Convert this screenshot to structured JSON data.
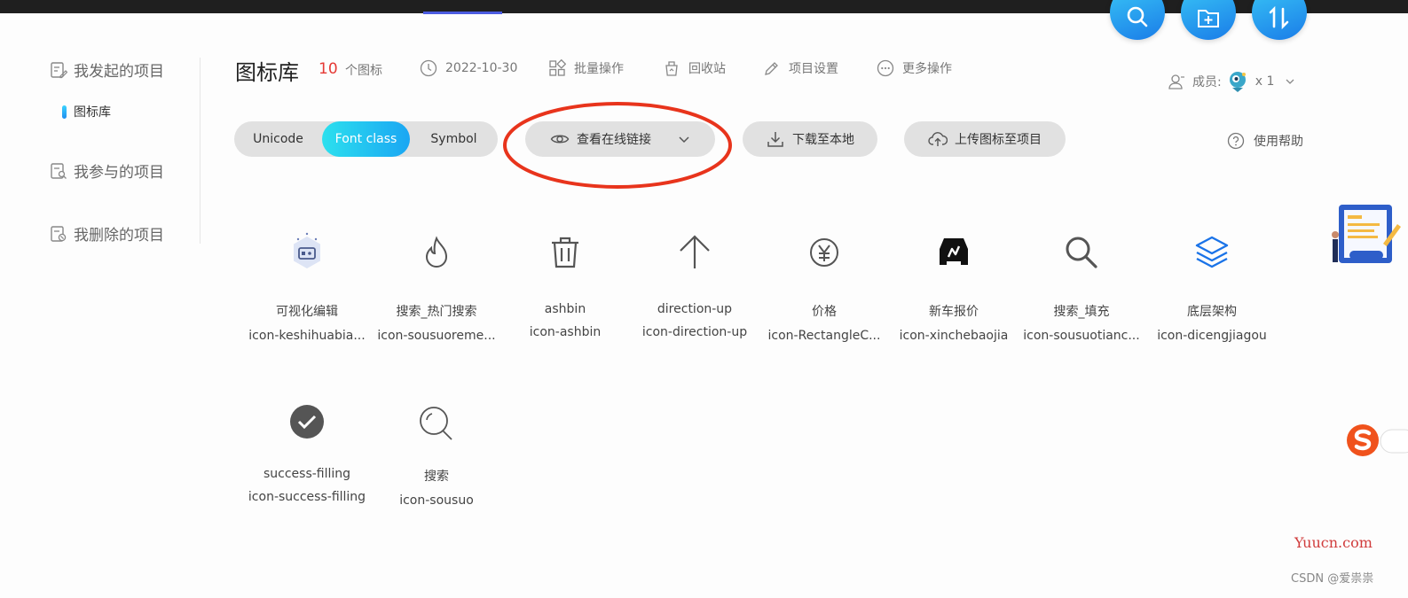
{
  "header": {
    "title": "图标库",
    "icon_count": "10",
    "icon_count_unit": "个图标",
    "date": "2022-10-30",
    "batch": "批量操作",
    "recycle": "回收站",
    "settings": "项目设置",
    "more": "更多操作",
    "members_label": "成员:",
    "members_count": "x 1"
  },
  "sidebar": {
    "initiated": "我发起的项目",
    "active_project": "图标库",
    "joined": "我参与的项目",
    "deleted": "我删除的项目"
  },
  "toolbar": {
    "formats": [
      "Unicode",
      "Font class",
      "Symbol"
    ],
    "active_format": "Font class",
    "view_link": "查看在线链接",
    "download": "下载至本地",
    "upload": "上传图标至项目",
    "help": "使用帮助"
  },
  "icons": [
    {
      "name": "可视化编辑",
      "class": "icon-keshihuabia...",
      "glyph": "visual-edit-icon"
    },
    {
      "name": "搜索_热门搜索",
      "class": "icon-sousuoreme...",
      "glyph": "flame-icon"
    },
    {
      "name": "ashbin",
      "class": "icon-ashbin",
      "glyph": "trash-icon"
    },
    {
      "name": "direction-up",
      "class": "icon-direction-up",
      "glyph": "arrow-up-icon"
    },
    {
      "name": "价格",
      "class": "icon-RectangleC...",
      "glyph": "yen-icon"
    },
    {
      "name": "新车报价",
      "class": "icon-xinchebaojia",
      "glyph": "car-icon"
    },
    {
      "name": "搜索_填充",
      "class": "icon-sousuotianc...",
      "glyph": "search-bold-icon"
    },
    {
      "name": "底层架构",
      "class": "icon-dicengjiagou",
      "glyph": "layers-icon"
    },
    {
      "name": "success-filling",
      "class": "icon-success-filling",
      "glyph": "check-circle-icon"
    },
    {
      "name": "搜索",
      "class": "icon-sousuo",
      "glyph": "search-thin-icon"
    }
  ],
  "watermark": "Yuucn.com",
  "credit": "CSDN @爱祟祟",
  "colors": {
    "accent": "#1aa6f3",
    "count": "#e53935",
    "annotation": "#e8341c",
    "layers": "#1a73e8"
  }
}
